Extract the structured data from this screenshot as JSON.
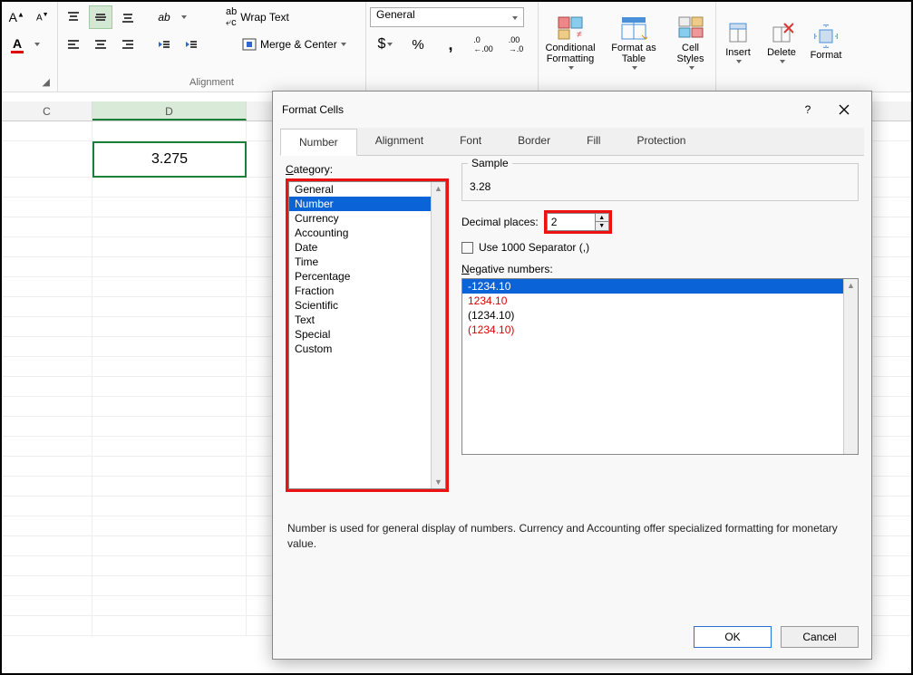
{
  "ribbon": {
    "wrap_text": "Wrap Text",
    "merge_center": "Merge & Center",
    "alignment_label": "Alignment",
    "num_format": "General",
    "conditional": "Conditional Formatting",
    "format_table": "Format as Table",
    "cell_styles": "Cell Styles",
    "insert": "Insert",
    "delete": "Delete",
    "format": "Format"
  },
  "grid": {
    "col_c": "C",
    "col_d": "D",
    "cell_value": "3.275"
  },
  "dialog": {
    "title": "Format Cells",
    "help": "?",
    "tabs": [
      "Number",
      "Alignment",
      "Font",
      "Border",
      "Fill",
      "Protection"
    ],
    "active_tab": 0,
    "category_label": "Category:",
    "categories": [
      "General",
      "Number",
      "Currency",
      "Accounting",
      "Date",
      "Time",
      "Percentage",
      "Fraction",
      "Scientific",
      "Text",
      "Special",
      "Custom"
    ],
    "selected_category": 1,
    "sample_label": "Sample",
    "sample_value": "3.28",
    "decimal_label": "Decimal places:",
    "decimal_value": "2",
    "sep_label": "Use 1000 Separator (,)",
    "neg_label": "Negative numbers:",
    "neg_items": [
      "-1234.10",
      "1234.10",
      "(1234.10)",
      "(1234.10)"
    ],
    "neg_selected": 0,
    "description": "Number is used for general display of numbers.  Currency and Accounting offer specialized formatting for monetary value.",
    "ok": "OK",
    "cancel": "Cancel"
  }
}
